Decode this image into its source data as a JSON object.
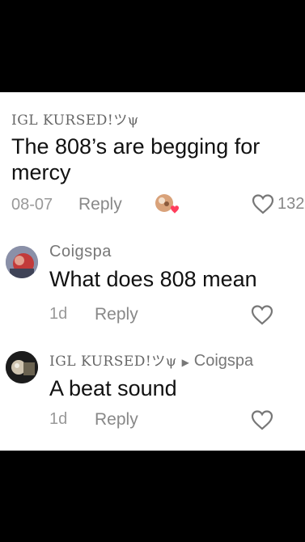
{
  "colors": {
    "background": "#000000",
    "panel": "#ffffff",
    "like_red": "#ff3d5c"
  },
  "comments": [
    {
      "username": "IGL KURSED!ツψ",
      "text": "The 808’s are begging for mercy",
      "date": "08-07",
      "reply_label": "Reply",
      "like_count": "132",
      "creator_liked": true
    },
    {
      "username": "Coigspa",
      "text": "What does 808 mean",
      "date": "1d",
      "reply_label": "Reply"
    },
    {
      "username": "IGL KURSED!ツψ",
      "reply_to": "Coigspa",
      "text": "A beat sound",
      "date": "1d",
      "reply_label": "Reply"
    }
  ]
}
